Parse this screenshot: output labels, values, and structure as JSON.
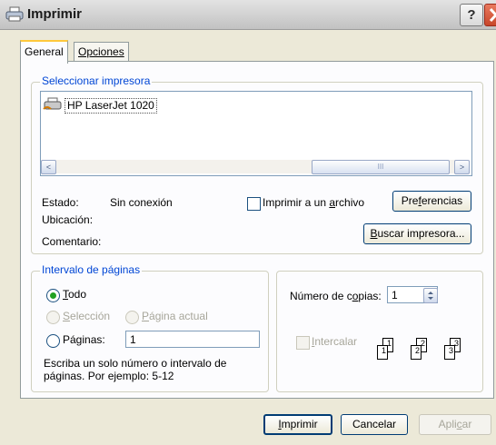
{
  "window": {
    "title": "Imprimir",
    "help_label": "?"
  },
  "tabs": [
    {
      "label": "General",
      "active": true
    },
    {
      "label": "Opciones",
      "active": false
    }
  ],
  "printer_group": {
    "legend": "Seleccionar impresora",
    "printers": [
      {
        "name": "HP LaserJet 1020",
        "selected": true
      }
    ],
    "scroll_left": "<",
    "scroll_right": ">",
    "scroll_thumb": "III"
  },
  "printer_info": {
    "status_label": "Estado:",
    "status_value": "Sin conexión",
    "location_label": "Ubicación:",
    "comment_label": "Comentario:",
    "print_to_file_pre": "Imprimir a un ",
    "print_to_file_u": "a",
    "print_to_file_post": "rchivo",
    "print_to_file_checked": false,
    "preferences_pre": "Pre",
    "preferences_u": "f",
    "preferences_post": "erencias",
    "find_printer_u": "B",
    "find_printer_post": "uscar impresora..."
  },
  "page_range": {
    "legend": "Intervalo de páginas",
    "all_u": "T",
    "all_post": "odo",
    "selection_u": "S",
    "selection_post": "elección",
    "current_u": "P",
    "current_post": "ágina actual",
    "pages_label": "Páginas:",
    "pages_value": "1",
    "hint_line1": "Escriba un solo número o intervalo de",
    "hint_line2": "páginas. Por ejemplo: 5-12",
    "selected_option": "all"
  },
  "copies": {
    "label_pre": "Número de c",
    "label_u": "o",
    "label_post": "pias:",
    "value": "1",
    "collate_u": "I",
    "collate_post": "ntercalar",
    "collate_checked": false,
    "collate_pages": [
      "1",
      "1",
      "2",
      "2",
      "3",
      "3"
    ]
  },
  "buttons": {
    "print_u": "I",
    "print_post": "mprimir",
    "cancel": "Cancelar",
    "apply_pre": "Apli",
    "apply_u": "c",
    "apply_post": "ar"
  }
}
